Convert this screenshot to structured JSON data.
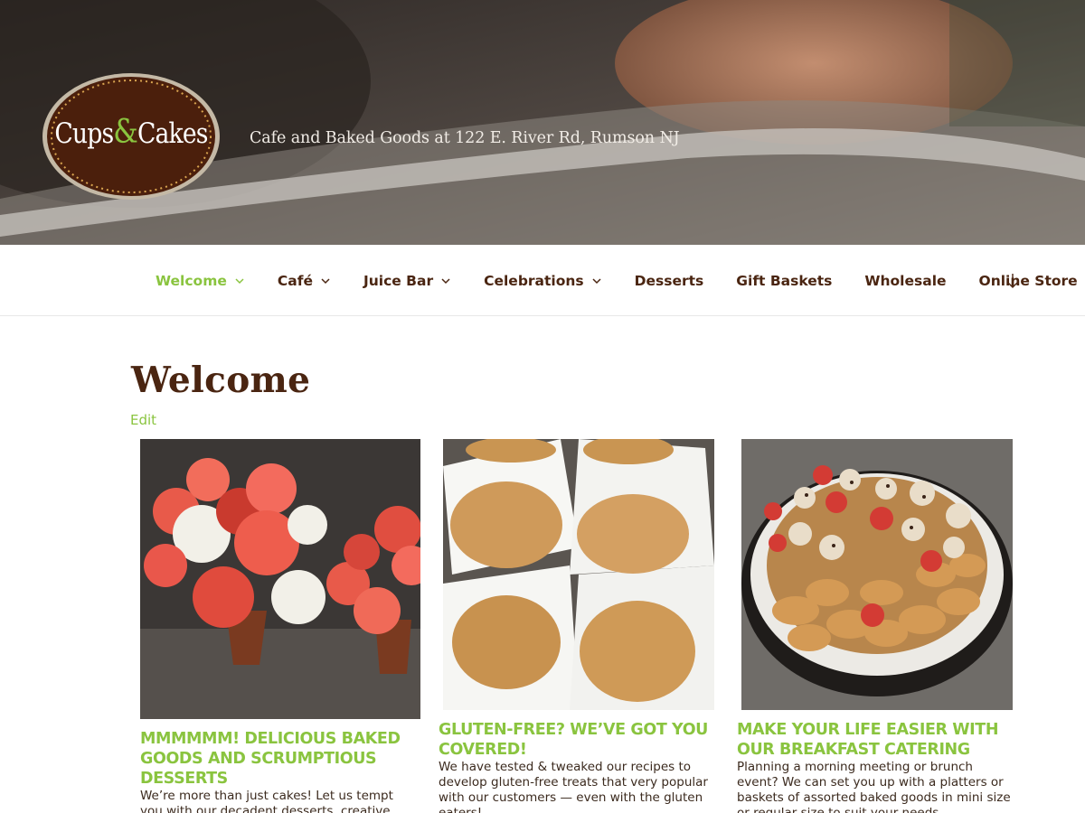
{
  "header": {
    "logo": {
      "word1": "Cups",
      "amp": "&",
      "word2": "Cakes"
    },
    "tagline": "Cafe and Baked Goods at 122 E. River Rd, Rumson NJ"
  },
  "nav": {
    "items": [
      {
        "label": "Welcome",
        "has_dropdown": true,
        "active": true
      },
      {
        "label": "Café",
        "has_dropdown": true
      },
      {
        "label": "Juice Bar",
        "has_dropdown": true
      },
      {
        "label": "Celebrations",
        "has_dropdown": true
      },
      {
        "label": "Desserts",
        "has_dropdown": false
      },
      {
        "label": "Gift Baskets",
        "has_dropdown": false
      },
      {
        "label": "Wholesale",
        "has_dropdown": false
      },
      {
        "label": "Online Store",
        "has_dropdown": false
      }
    ],
    "accent_color": "#8ac43f",
    "text_color": "#4a2511"
  },
  "main": {
    "title": "Welcome",
    "edit_label": "Edit",
    "cards": [
      {
        "image": "cupcake-bouquet-photo",
        "title": "MMMMMM! Delicious baked goods and scrumptious desserts",
        "text": "We’re more than just cakes! Let us tempt you with our decadent desserts, creative cookies"
      },
      {
        "image": "gluten-free-muffins-photo",
        "title": "Gluten-free? We’ve got you covered!",
        "text": "We have tested & tweaked our recipes to develop gluten-free treats that very popular with our customers — even with the gluten eaters!"
      },
      {
        "image": "breakfast-pastry-platter-photo",
        "title": "Make your life easier with our breakfast catering",
        "text": "Planning a morning meeting or brunch event? We can set you up with a platters or baskets of assorted baked goods in mini size or regular size to suit your needs."
      }
    ]
  }
}
